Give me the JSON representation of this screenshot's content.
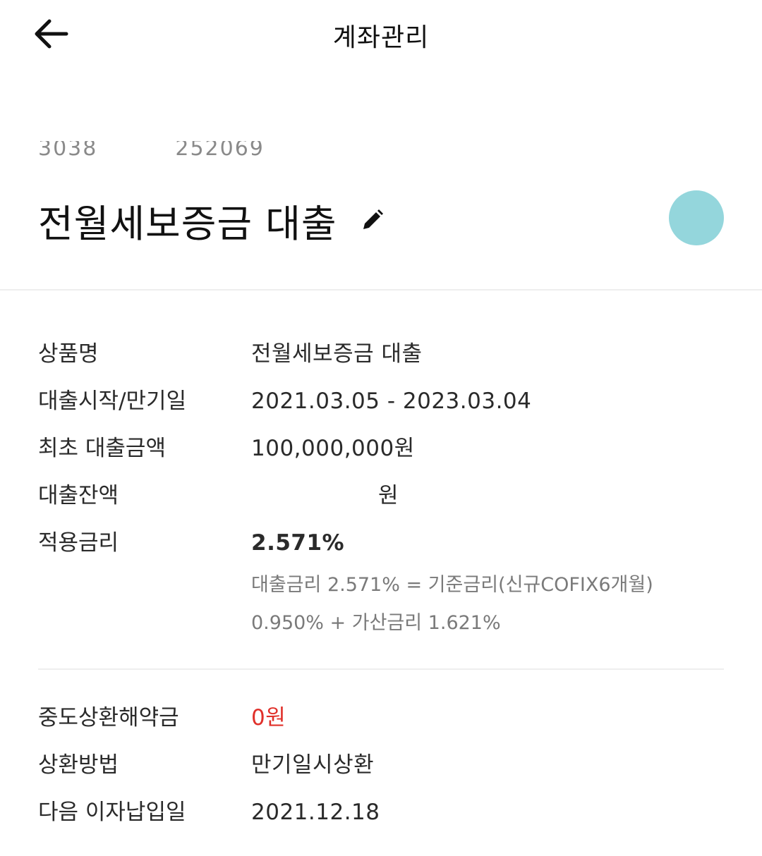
{
  "header": {
    "title": "계좌관리",
    "back_icon": "arrow-left-icon"
  },
  "account": {
    "number_prefix": "3038",
    "number_suffix": "252069",
    "product_name": "전월세보증금 대출",
    "edit_icon": "pencil-icon",
    "logo_color": "#94d6dc"
  },
  "details": [
    {
      "label": "상품명",
      "value": "전월세보증금 대출"
    },
    {
      "label": "대출시작/만기일",
      "value": "2021.03.05 - 2023.03.04"
    },
    {
      "label": "최초 대출금액",
      "value": "100,000,000원"
    },
    {
      "label": "대출잔액",
      "value": "원"
    },
    {
      "label": "적용금리",
      "value": "2.571%"
    }
  ],
  "rate_note": {
    "line1": "대출금리 2.571% = 기준금리(신규COFIX6개월)",
    "line2": "0.950% + 가산금리 1.621%"
  },
  "details2": [
    {
      "label": "중도상환해약금",
      "value": "0원"
    },
    {
      "label": "상환방법",
      "value": "만기일시상환"
    },
    {
      "label": "다음 이자납입일",
      "value": "2021.12.18"
    }
  ],
  "colors": {
    "accent_red": "#e0302a",
    "muted_text": "#7a7a7a"
  }
}
